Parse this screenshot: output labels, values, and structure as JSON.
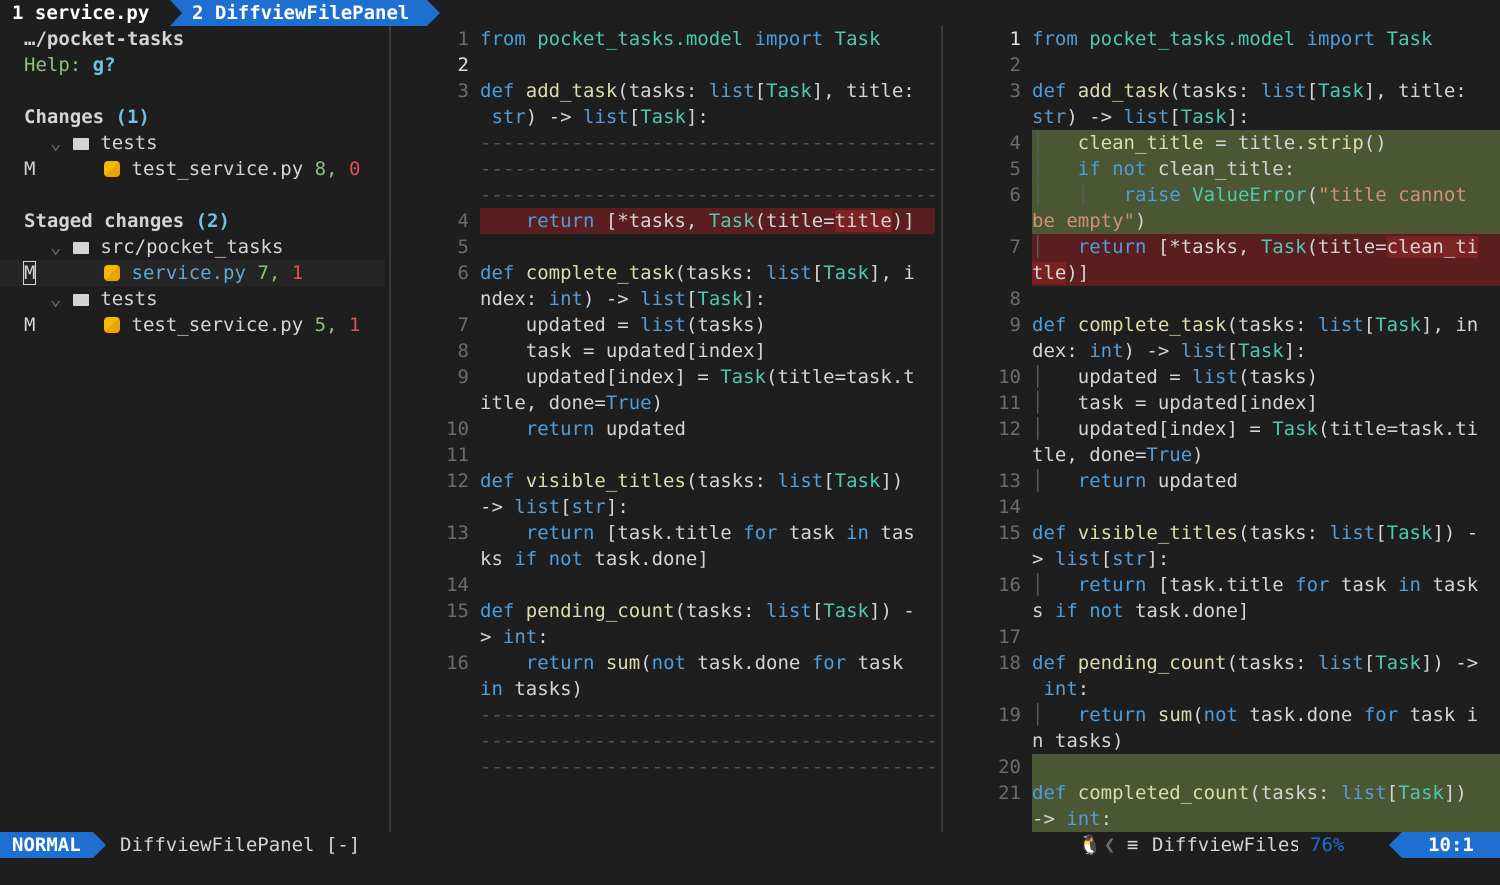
{
  "tabs": [
    {
      "label": "1 service.py"
    },
    {
      "label": "2 DiffviewFilePanel"
    }
  ],
  "sidebar": {
    "path": "…/pocket-tasks",
    "help_label": "Help:",
    "help_key": "g?",
    "changes_title": "Changes",
    "changes_count": "(1)",
    "changes": [
      {
        "folder": "tests",
        "files": [
          {
            "status": "M",
            "name": "test_service.py",
            "add": "8,",
            "del": "0"
          }
        ]
      }
    ],
    "staged_title": "Staged changes",
    "staged_count": "(2)",
    "staged": [
      {
        "folder": "src/pocket_tasks",
        "files": [
          {
            "status": "M",
            "name": "service.py",
            "add": "7,",
            "del": "1"
          }
        ]
      },
      {
        "folder": "tests",
        "files": [
          {
            "status": "M",
            "name": "test_service.py",
            "add": "5,",
            "del": "1"
          }
        ]
      }
    ]
  },
  "statusbar": {
    "mode": "NORMAL",
    "buffer": "DiffviewFilePanel [-]",
    "filetype": "DiffviewFiles",
    "percent": "76%",
    "position": "10:1"
  },
  "colors": {
    "accent": "#1f6fd1",
    "added": "#4b5632",
    "deleted": "#5a1e1e"
  }
}
